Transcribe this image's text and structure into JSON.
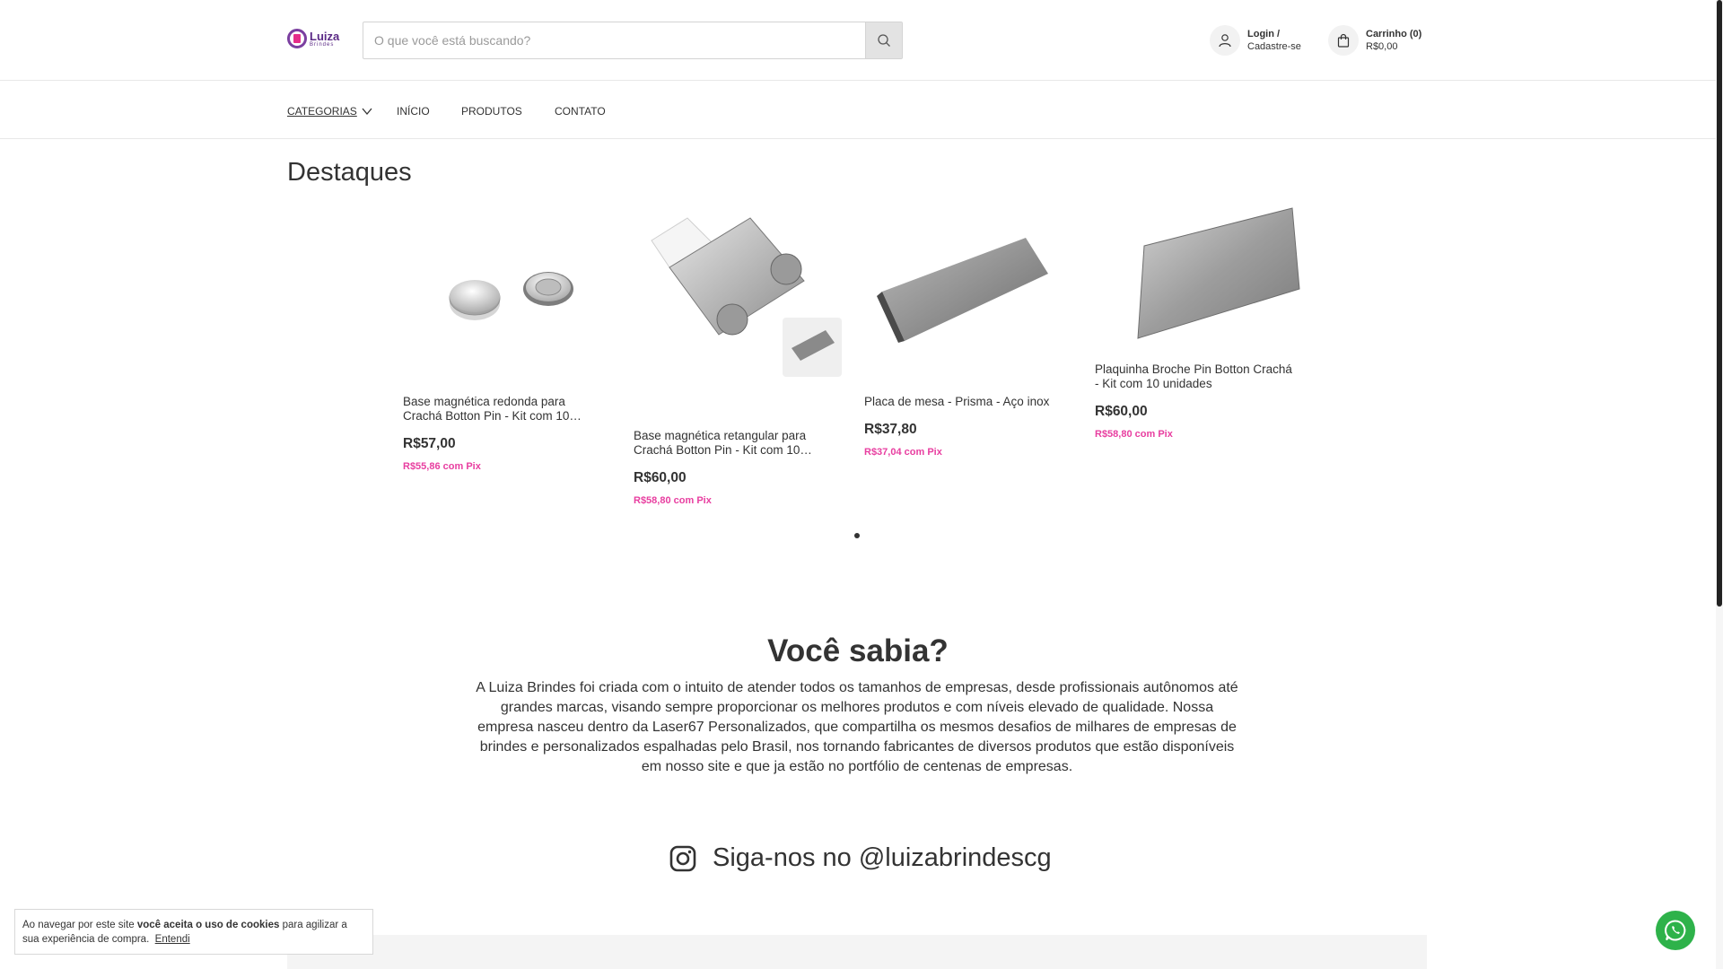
{
  "brand": {
    "name": "Luiza",
    "sub": "Brindes",
    "colors": {
      "purple": "#5b2a86",
      "pink": "#e52e8a",
      "pix_pink": "#e83ea0",
      "whatsapp": "#2eb24a"
    }
  },
  "search": {
    "placeholder": "O que você está buscando?",
    "value": "",
    "icon": "search-icon"
  },
  "account": {
    "line1": "Login /",
    "line2": "Cadastre-se",
    "icon": "user-icon"
  },
  "cart": {
    "line1": "Carrinho (0)",
    "line2": "R$0,00",
    "icon": "shopping-bag-icon"
  },
  "nav": {
    "categories": "CATEGORIAS",
    "home": "INÍCIO",
    "products": "PRODUTOS",
    "contact": "CONTATO"
  },
  "featured": {
    "title": "Destaques",
    "products": [
      {
        "name": "Base magnética redonda para Crachá Botton Pin - Kit com 10…",
        "price": "R$57,00",
        "pix": "R$55,86 com Pix"
      },
      {
        "name": "Base magnética retangular para Crachá Botton Pin - Kit com 10…",
        "price": "R$60,00",
        "pix": "R$58,80 com Pix"
      },
      {
        "name": "Placa de mesa - Prisma - Aço inox",
        "price": "R$37,80",
        "pix": "R$37,04 com Pix"
      },
      {
        "name": "Plaquinha Broche Pin Botton Crachá - Kit com 10 unidades",
        "price": "R$60,00",
        "pix": "R$58,80 com Pix"
      }
    ]
  },
  "about": {
    "title": "Você sabia?",
    "text": "A Luiza Brindes foi criada com o intuito de atender todos os tamanhos de empresas, desde profissionais autônomos até grandes marcas, visando sempre proporcionar os melhores produtos e com níveis elevado de qualidade. Nossa empresa nasceu dentro da Laser67 Personalizados, que compartilha os mesmos desafios de milhares de empresas de brindes e personalizados espalhadas pelo Brasil, nos tornando fabricantes de diversos produtos que estão disponíveis em nosso site e que ja estão no portfólio de centenas de empresas."
  },
  "instagram": {
    "label": "Siga-nos no @luizabrindescg",
    "icon": "instagram-icon"
  },
  "cookie": {
    "prefix": "Ao navegar por este site ",
    "bold": "você aceita o uso de cookies",
    "suffix": " para agilizar a sua experiência de compra.",
    "accept": "Entendi"
  },
  "whatsapp": {
    "icon": "whatsapp-icon"
  }
}
